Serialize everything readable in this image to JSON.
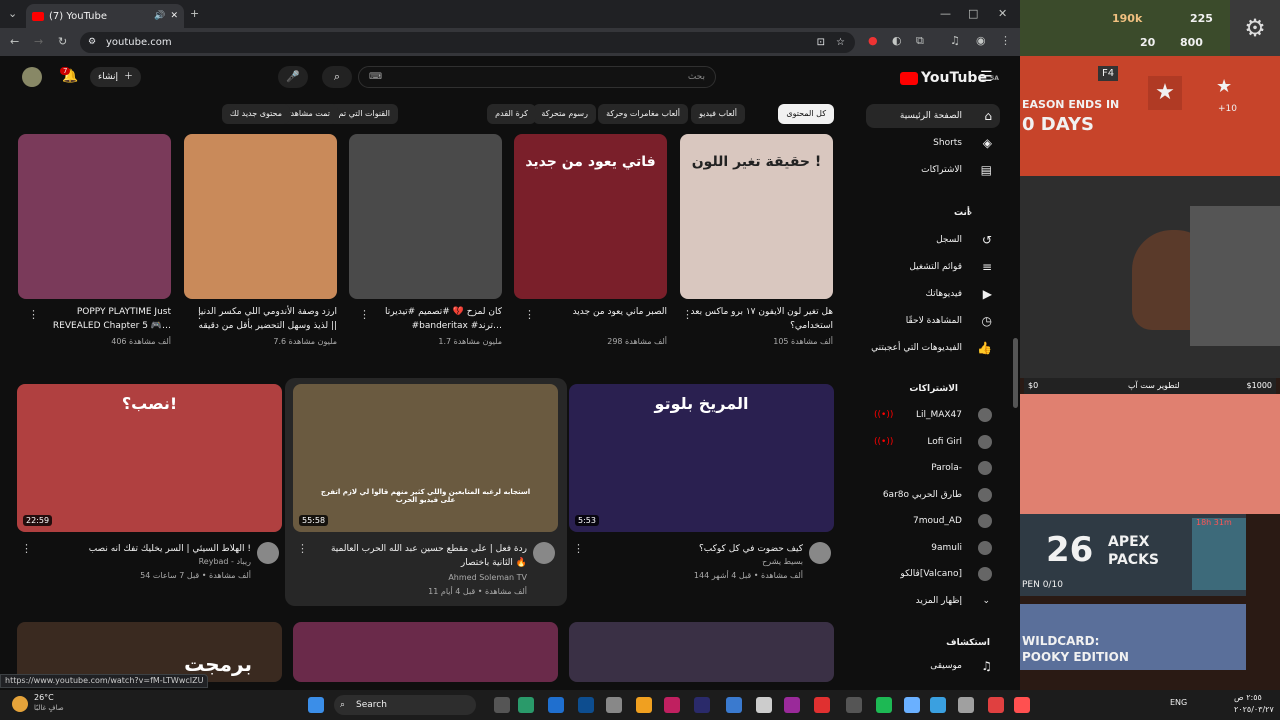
{
  "browser": {
    "tab_title": "(7) YouTube",
    "url": "youtube.com",
    "status_url": "https://www.youtube.com/watch?v=fM-LTWwcIZU"
  },
  "yt": {
    "logo": "YouTube",
    "region": "SA",
    "search_placeholder": "بحث",
    "create_label": "إنشاء",
    "notif_count": "7",
    "chips": [
      "كل المحتوى",
      "ألعاب فيديو",
      "ألعاب مغامرات وحركة",
      "رسوم متحركة",
      "كرة القدم",
      "القنوات التي تم تحميلها مؤخرًا",
      "تمت مشاهدتها",
      "محتوى جديد لك"
    ],
    "sidebar": {
      "main": [
        {
          "label": "الصفحة الرئيسية",
          "icon": "home-icon",
          "g": "⌂"
        },
        {
          "label": "Shorts",
          "icon": "shorts-icon",
          "g": "◈"
        },
        {
          "label": "الاشتراكات",
          "icon": "subscriptions-icon",
          "g": "▤"
        }
      ],
      "you_header": "أنت",
      "you": [
        {
          "label": "السجل",
          "icon": "history-icon",
          "g": "↺"
        },
        {
          "label": "قوائم التشغيل",
          "icon": "playlist-icon",
          "g": "≡"
        },
        {
          "label": "فيديوهاتك",
          "icon": "your-videos-icon",
          "g": "▶"
        },
        {
          "label": "المشاهدة لاحقًا",
          "icon": "watch-later-icon",
          "g": "◷"
        },
        {
          "label": "الفيديوهات التي أعجبتني",
          "icon": "liked-icon",
          "g": "👍"
        }
      ],
      "subs_header": "الاشتراكات",
      "subs": [
        "Lil_MAX47",
        "Lofi Girl",
        "Parola-",
        "6ar8o طارق الحربي",
        "7moud_AD",
        "9amuli",
        "ڤالكو[Valcano]"
      ],
      "show_more": "إظهار المزيد",
      "explore_header": "استكشاف",
      "explore": [
        {
          "label": "موسيقى",
          "icon": "music-icon",
          "g": "♫"
        }
      ]
    },
    "row1": [
      {
        "title": "هل تغير لون الايفون ١٧ برو ماكس بعد استخدامي؟",
        "meta": "105 ألف مشاهدة",
        "thumb": "#d9c7bf",
        "thumb_text": "حقيقة تغير اللون !"
      },
      {
        "title": "الصبر ماني يعود من جديد",
        "meta": "298 ألف مشاهدة",
        "thumb": "#7a1f2a",
        "thumb_text": "فاتي يعود من جديد"
      },
      {
        "title": "كان لمزح 💔 #تصميم #تيديرتا #banderitax #ترند…",
        "meta": "1.7 مليون مشاهدة",
        "thumb": "#4a4a4a",
        "thumb_text": ""
      },
      {
        "title": "ارزد وصفة الأندومي اللي مكسر الدنيا || لذيذ وسهل التحضير بأقل من دقيقه",
        "meta": "7.6 مليون مشاهدة",
        "thumb": "#c98a5a",
        "thumb_text": ""
      },
      {
        "title": "POPPY PLAYTIME Just REVEALED Chapter 5 🎮…",
        "meta": "406 ألف مشاهدة",
        "thumb": "#7a3a5a",
        "thumb_text": ""
      }
    ],
    "row2": [
      {
        "title": "كيف حضوت في كل كوكب؟",
        "channel": "بسيط يشرح",
        "meta": "144 ألف مشاهدة • قبل 4 أشهر",
        "dur": "5:53",
        "thumb": "#2a2050",
        "thumb_text": "المريخ  بلوتو"
      },
      {
        "title": "ردة فعل | على مقطع حسين عبد الله الحرب العالمية الثانية باختصار 🔥",
        "channel": "Ahmed Soleman TV",
        "meta": "11 ألف مشاهدة • قبل 4 أيام",
        "dur": "55:58",
        "thumb": "#6a5a40",
        "thumb_text": "استجابه لرغبه المتابعين واللي كثير منهم قالوا لي لازم اتفرج على فيديو الحرب"
      },
      {
        "title": "الهلاط السيئي | السر يخليك تفك انه نصب !",
        "channel": "Reybad - ريباد",
        "meta": "54 ألف مشاهدة • قبل 7 ساعات",
        "dur": "22:59",
        "thumb": "#b04040",
        "thumb_text": "نصب؟!"
      }
    ],
    "row3_text": "برمجت"
  },
  "stream": {
    "coins": "190k",
    "stat2": "225",
    "stat3": "20",
    "stat4": "800",
    "season_label": "EASON ENDS IN",
    "days": "0 DAYS",
    "key": "F4",
    "plus": "+10",
    "bar_left": "$0",
    "bar_mid": "لتطوير ست آپ",
    "bar_right": "$1000",
    "apex_num": "26",
    "apex_label1": "APEX",
    "apex_label2": "PACKS",
    "apex_timer": "18h 31m",
    "apex_open": "PEN 0/10",
    "wild1": "WILDCARD:",
    "wild2": "POOKY EDITION"
  },
  "taskbar": {
    "weather_temp": "26°C",
    "weather_desc": "صافٍ غالبًا",
    "search": "Search",
    "lang": "ENG",
    "time": "٢:٥٥ ص",
    "date": "٢٠٢٥/٠٣/٢٧"
  }
}
